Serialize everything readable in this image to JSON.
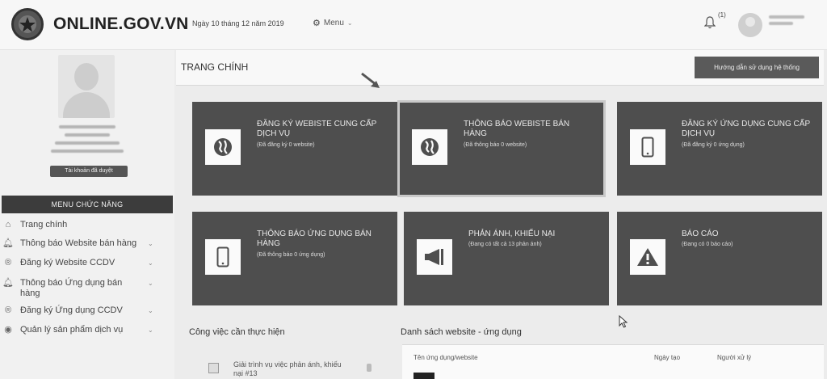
{
  "header": {
    "site_name": "ONLINE.GOV.VN",
    "date": "Ngày 10 tháng 12 năm 2019",
    "menu_label": "Menu",
    "notification_count": "(1)"
  },
  "sidebar": {
    "account_badge": "Tài khoản đã duyệt",
    "menu_header": "MENU CHỨC NĂNG",
    "items": [
      {
        "label": "Trang chính",
        "icon": "home-icon"
      },
      {
        "label": "Thông báo Website bán hàng",
        "icon": "bell-icon"
      },
      {
        "label": "Đăng ký Website CCDV",
        "icon": "registered-icon"
      },
      {
        "label": "Thông báo Ứng dụng bán hàng",
        "icon": "bell-icon"
      },
      {
        "label": "Đăng ký Ứng dụng CCDV",
        "icon": "registered-icon"
      },
      {
        "label": "Quản lý sản phẩm dịch vụ",
        "icon": "tag-icon"
      }
    ]
  },
  "main": {
    "title": "TRANG CHÍNH",
    "guide_button": "Hướng dẫn sử dụng hệ thống",
    "tiles": [
      {
        "title": "ĐĂNG KÝ WEBISTE CUNG CẤP DỊCH VỤ",
        "subtitle": "(Đã đăng ký 0 website)",
        "icon": "globe-icon"
      },
      {
        "title": "THÔNG BÁO WEBISTE BÁN HÀNG",
        "subtitle": "(Đã thông báo 0 website)",
        "icon": "globe-icon"
      },
      {
        "title": "ĐĂNG KÝ ỨNG DỤNG CUNG CẤP DỊCH VỤ",
        "subtitle": "(Đã đăng ký 0 ứng dụng)",
        "icon": "mobile-icon"
      },
      {
        "title": "THÔNG BÁO ỨNG DỤNG BÁN HÀNG",
        "subtitle": "(Đã thông báo 0 ứng dụng)",
        "icon": "mobile-icon"
      },
      {
        "title": "PHẢN ÁNH, KHIẾU NẠI",
        "subtitle": "(Đang có tất cả 13 phản ánh)",
        "icon": "megaphone-icon"
      },
      {
        "title": "BÁO CÁO",
        "subtitle": "(Đang có 0 báo cáo)",
        "icon": "warning-icon"
      }
    ],
    "tasks_title": "Công việc cần thực hiện",
    "task_item": "Giải trình vụ việc phản ánh, khiếu nại #13",
    "list_title": "Danh sách website - ứng dụng",
    "list_columns": [
      "Tên ứng dụng/website",
      "Ngày tạo",
      "Người xử lý"
    ]
  }
}
